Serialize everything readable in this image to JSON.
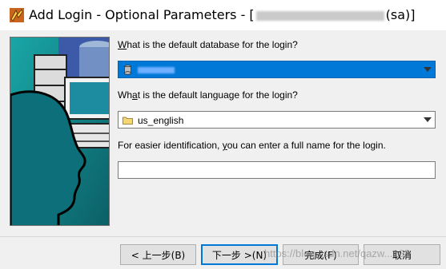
{
  "window": {
    "title_prefix": "Add Login - Optional Parameters - [",
    "title_suffix": "(sa)]"
  },
  "form": {
    "database_label_u": "W",
    "database_label_rest": "hat is the default database for the login?",
    "language_label_prefix": "Wh",
    "language_label_u": "a",
    "language_label_rest": "t is the default language for the login?",
    "language_value": "us_english",
    "fullname_label_prefix": "For easier identification, ",
    "fullname_label_u": "y",
    "fullname_label_rest": "ou can enter a full name for the login.",
    "fullname_value": ""
  },
  "buttons": {
    "back": "< 上一步(B)",
    "next": "下一步 >(N)",
    "finish": "完成(F)",
    "cancel": "取消"
  },
  "watermark": "https://blog.csdn.net/qazw...103",
  "colors": {
    "selection": "#0078d7",
    "illustration_bg": "#0e8a8a"
  },
  "icons": {
    "app": "wizard-app-icon",
    "database": "database-icon",
    "language": "folder-icon"
  }
}
